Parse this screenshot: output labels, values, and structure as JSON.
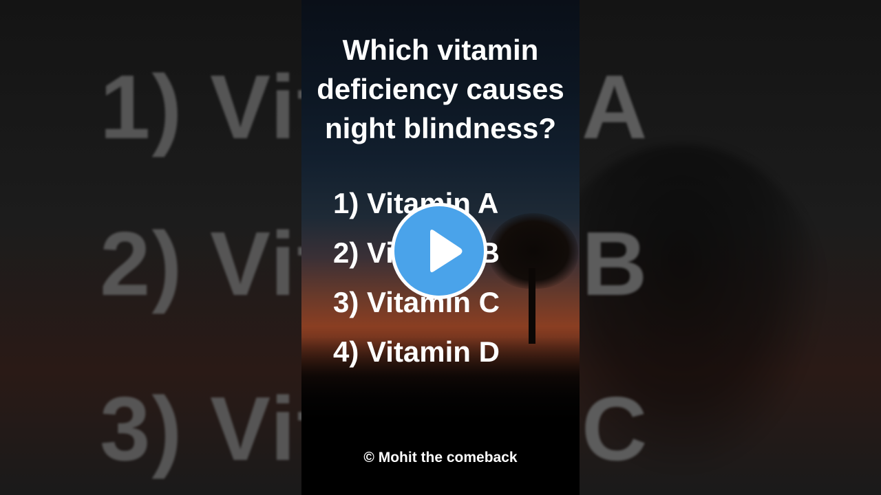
{
  "background": {
    "left_lines": [
      "1) Vit",
      "2) Vit",
      "3) Vit"
    ],
    "right_letters": [
      "A",
      "B",
      "C"
    ]
  },
  "video": {
    "question": "Which vitamin\ndeficiency causes\nnight blindness?",
    "options": [
      "1) Vitamin A",
      "2) Vitamin B",
      "3) Vitamin C",
      "4) Vitamin D"
    ],
    "copyright": "© Mohit the comeback"
  },
  "player": {
    "play_icon": "play-icon",
    "accent_color": "#4aa3ea"
  }
}
